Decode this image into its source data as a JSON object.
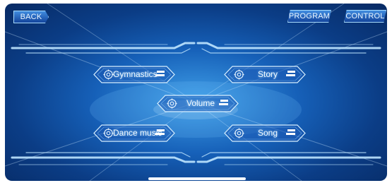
{
  "top_bar": {
    "back_label": "BACK",
    "program_label": "PROGRAM",
    "control_label": "CONTROL"
  },
  "menu": {
    "gymnastics": "Gymnastics",
    "story": "Story",
    "volume": "Volume",
    "dance_music": "Dance music",
    "song": "Song"
  },
  "icons": {
    "menu_gear": "gear-icon",
    "menu_flag": "flag-icon"
  },
  "colors": {
    "background_center": "#3f9fe8",
    "background_edge": "#072a64",
    "accent_glow": "#a9ddff"
  }
}
